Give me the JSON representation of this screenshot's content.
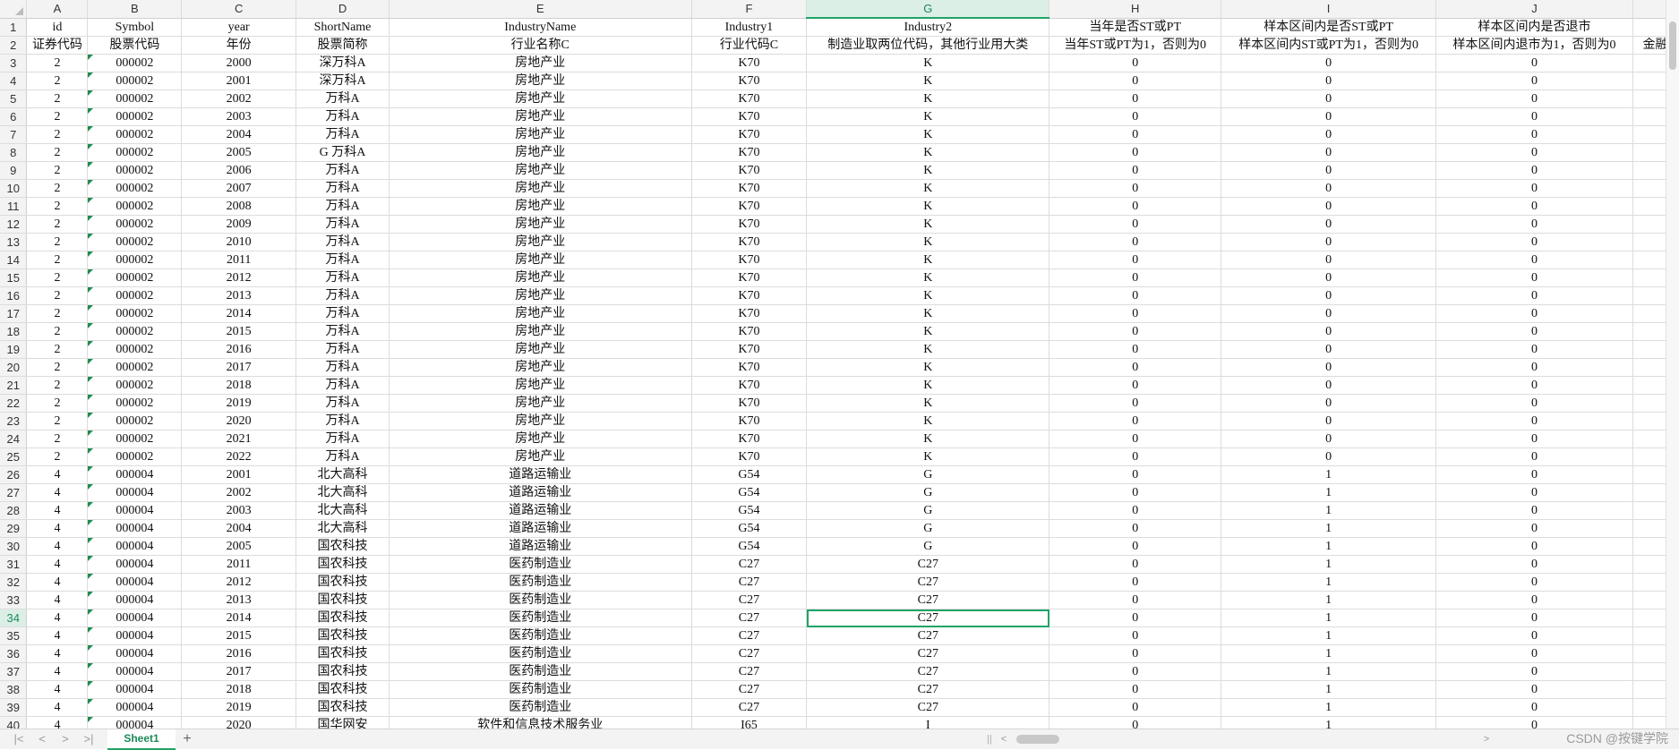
{
  "selected_cell": "G34",
  "columns": [
    {
      "letter": "A",
      "key": "id"
    },
    {
      "letter": "B",
      "key": "symbol"
    },
    {
      "letter": "C",
      "key": "year"
    },
    {
      "letter": "D",
      "key": "short"
    },
    {
      "letter": "E",
      "key": "industry"
    },
    {
      "letter": "F",
      "key": "ind1"
    },
    {
      "letter": "G",
      "key": "ind2"
    },
    {
      "letter": "H",
      "key": "h"
    },
    {
      "letter": "I",
      "key": "i"
    },
    {
      "letter": "J",
      "key": "j"
    },
    {
      "letter": "",
      "key": "k"
    }
  ],
  "header_row1": [
    "id",
    "Symbol",
    "year",
    "ShortName",
    "IndustryName",
    "Industry1",
    "Industry2",
    "当年是否ST或PT",
    "样本区间内是否ST或PT",
    "样本区间内是否退市",
    ""
  ],
  "header_row2": [
    "证券代码",
    "股票代码",
    "年份",
    "股票简称",
    "行业名称C",
    "行业代码C",
    "制造业取两位代码，其他行业用大类",
    "当年ST或PT为1，否则为0",
    "样本区间内ST或PT为1，否则为0",
    "样本区间内退市为1，否则为0",
    "金融"
  ],
  "rows": [
    [
      "2",
      "000002",
      "2000",
      "深万科A",
      "房地产业",
      "K70",
      "K",
      "0",
      "0",
      "0"
    ],
    [
      "2",
      "000002",
      "2001",
      "深万科A",
      "房地产业",
      "K70",
      "K",
      "0",
      "0",
      "0"
    ],
    [
      "2",
      "000002",
      "2002",
      "万科A",
      "房地产业",
      "K70",
      "K",
      "0",
      "0",
      "0"
    ],
    [
      "2",
      "000002",
      "2003",
      "万科A",
      "房地产业",
      "K70",
      "K",
      "0",
      "0",
      "0"
    ],
    [
      "2",
      "000002",
      "2004",
      "万科A",
      "房地产业",
      "K70",
      "K",
      "0",
      "0",
      "0"
    ],
    [
      "2",
      "000002",
      "2005",
      "G 万科A",
      "房地产业",
      "K70",
      "K",
      "0",
      "0",
      "0"
    ],
    [
      "2",
      "000002",
      "2006",
      "万科A",
      "房地产业",
      "K70",
      "K",
      "0",
      "0",
      "0"
    ],
    [
      "2",
      "000002",
      "2007",
      "万科A",
      "房地产业",
      "K70",
      "K",
      "0",
      "0",
      "0"
    ],
    [
      "2",
      "000002",
      "2008",
      "万科A",
      "房地产业",
      "K70",
      "K",
      "0",
      "0",
      "0"
    ],
    [
      "2",
      "000002",
      "2009",
      "万科A",
      "房地产业",
      "K70",
      "K",
      "0",
      "0",
      "0"
    ],
    [
      "2",
      "000002",
      "2010",
      "万科A",
      "房地产业",
      "K70",
      "K",
      "0",
      "0",
      "0"
    ],
    [
      "2",
      "000002",
      "2011",
      "万科A",
      "房地产业",
      "K70",
      "K",
      "0",
      "0",
      "0"
    ],
    [
      "2",
      "000002",
      "2012",
      "万科A",
      "房地产业",
      "K70",
      "K",
      "0",
      "0",
      "0"
    ],
    [
      "2",
      "000002",
      "2013",
      "万科A",
      "房地产业",
      "K70",
      "K",
      "0",
      "0",
      "0"
    ],
    [
      "2",
      "000002",
      "2014",
      "万科A",
      "房地产业",
      "K70",
      "K",
      "0",
      "0",
      "0"
    ],
    [
      "2",
      "000002",
      "2015",
      "万科A",
      "房地产业",
      "K70",
      "K",
      "0",
      "0",
      "0"
    ],
    [
      "2",
      "000002",
      "2016",
      "万科A",
      "房地产业",
      "K70",
      "K",
      "0",
      "0",
      "0"
    ],
    [
      "2",
      "000002",
      "2017",
      "万科A",
      "房地产业",
      "K70",
      "K",
      "0",
      "0",
      "0"
    ],
    [
      "2",
      "000002",
      "2018",
      "万科A",
      "房地产业",
      "K70",
      "K",
      "0",
      "0",
      "0"
    ],
    [
      "2",
      "000002",
      "2019",
      "万科A",
      "房地产业",
      "K70",
      "K",
      "0",
      "0",
      "0"
    ],
    [
      "2",
      "000002",
      "2020",
      "万科A",
      "房地产业",
      "K70",
      "K",
      "0",
      "0",
      "0"
    ],
    [
      "2",
      "000002",
      "2021",
      "万科A",
      "房地产业",
      "K70",
      "K",
      "0",
      "0",
      "0"
    ],
    [
      "2",
      "000002",
      "2022",
      "万科A",
      "房地产业",
      "K70",
      "K",
      "0",
      "0",
      "0"
    ],
    [
      "4",
      "000004",
      "2001",
      "北大高科",
      "道路运输业",
      "G54",
      "G",
      "0",
      "1",
      "0"
    ],
    [
      "4",
      "000004",
      "2002",
      "北大高科",
      "道路运输业",
      "G54",
      "G",
      "0",
      "1",
      "0"
    ],
    [
      "4",
      "000004",
      "2003",
      "北大高科",
      "道路运输业",
      "G54",
      "G",
      "0",
      "1",
      "0"
    ],
    [
      "4",
      "000004",
      "2004",
      "北大高科",
      "道路运输业",
      "G54",
      "G",
      "0",
      "1",
      "0"
    ],
    [
      "4",
      "000004",
      "2005",
      "国农科技",
      "道路运输业",
      "G54",
      "G",
      "0",
      "1",
      "0"
    ],
    [
      "4",
      "000004",
      "2011",
      "国农科技",
      "医药制造业",
      "C27",
      "C27",
      "0",
      "1",
      "0"
    ],
    [
      "4",
      "000004",
      "2012",
      "国农科技",
      "医药制造业",
      "C27",
      "C27",
      "0",
      "1",
      "0"
    ],
    [
      "4",
      "000004",
      "2013",
      "国农科技",
      "医药制造业",
      "C27",
      "C27",
      "0",
      "1",
      "0"
    ],
    [
      "4",
      "000004",
      "2014",
      "国农科技",
      "医药制造业",
      "C27",
      "C27",
      "0",
      "1",
      "0"
    ],
    [
      "4",
      "000004",
      "2015",
      "国农科技",
      "医药制造业",
      "C27",
      "C27",
      "0",
      "1",
      "0"
    ],
    [
      "4",
      "000004",
      "2016",
      "国农科技",
      "医药制造业",
      "C27",
      "C27",
      "0",
      "1",
      "0"
    ],
    [
      "4",
      "000004",
      "2017",
      "国农科技",
      "医药制造业",
      "C27",
      "C27",
      "0",
      "1",
      "0"
    ],
    [
      "4",
      "000004",
      "2018",
      "国农科技",
      "医药制造业",
      "C27",
      "C27",
      "0",
      "1",
      "0"
    ],
    [
      "4",
      "000004",
      "2019",
      "国农科技",
      "医药制造业",
      "C27",
      "C27",
      "0",
      "1",
      "0"
    ],
    [
      "4",
      "000004",
      "2020",
      "国华网安",
      "软件和信息技术服务业",
      "I65",
      "I",
      "0",
      "1",
      "0"
    ]
  ],
  "sheet_tab": "Sheet1",
  "add_sheet": "+",
  "nav": {
    "first": "|<",
    "prev": "<",
    "next": ">",
    "last": ">|"
  },
  "hscroll_split": "||",
  "hscroll_left": "<",
  "hscroll_right": ">",
  "watermark": "CSDN @按键学院"
}
